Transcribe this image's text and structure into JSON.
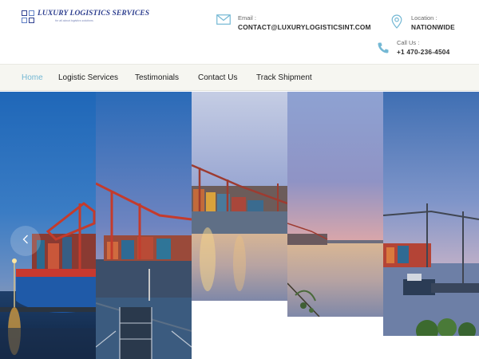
{
  "brand": {
    "title": "LUXURY LOGISTICS SERVICES",
    "tagline": "for all about logistics solutions"
  },
  "contact": {
    "email": {
      "label": "Email :",
      "value": "CONTACT@LUXURYLOGISTICSINT.COM",
      "icon": "envelope-icon"
    },
    "location": {
      "label": "Location :",
      "value": "NATIONWIDE",
      "icon": "map-pin-icon"
    },
    "call": {
      "label": "Call Us :",
      "value": "+1 470-236-4504",
      "icon": "phone-icon"
    }
  },
  "nav": {
    "items": [
      {
        "label": "Home",
        "active": true
      },
      {
        "label": "Logistic Services",
        "active": false
      },
      {
        "label": "Testimonials",
        "active": false
      },
      {
        "label": "Contact Us",
        "active": false
      },
      {
        "label": "Track Shipment",
        "active": false
      }
    ]
  },
  "hero": {
    "image": "container-port-at-dusk",
    "prev_icon": "chevron-left-icon"
  },
  "colors": {
    "brand_blue": "#2e3f8f",
    "accent": "#74b8d4",
    "nav_bg": "#f6f6f1"
  }
}
